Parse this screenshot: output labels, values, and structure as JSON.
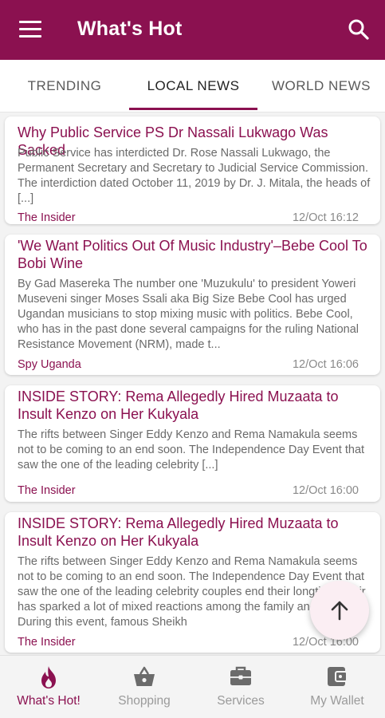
{
  "appbar": {
    "title": "What's Hot"
  },
  "tabs": [
    {
      "label": "TRENDING",
      "active": false
    },
    {
      "label": "LOCAL NEWS",
      "active": true
    },
    {
      "label": "WORLD NEWS",
      "active": false
    }
  ],
  "articles": [
    {
      "title": "Why Public Service PS Dr Nassali Lukwago Was Sacked",
      "summary": "Public Service has interdicted Dr. Rose Nassali Lukwago, the Permanent Secretary and Secretary to Judicial Service Commission. The interdiction dated October 11, 2019 by Dr. J. Mitala, the heads of [...]",
      "source": "The Insider",
      "time": "12/Oct 16:12"
    },
    {
      "title": "'We Want Politics Out Of Music Industry'–Bebe Cool To Bobi Wine",
      "summary": "By Gad Masereka The number one 'Muzukulu' to president Yoweri Museveni singer Moses Ssali aka Big Size Bebe Cool has urged Ugandan musicians to stop mixing music with politics. Bebe Cool, who has in the past done several campaigns for the ruling National Resistance Movement (NRM), made t...",
      "source": "Spy Uganda",
      "time": "12/Oct 16:06"
    },
    {
      "title": "INSIDE STORY: Rema Allegedly Hired Muzaata to Insult Kenzo on Her Kukyala",
      "summary": "The rifts between Singer Eddy Kenzo and Rema Namakula seems not to be coming to an end soon. The Independence Day Event that saw the one of the leading celebrity [...]",
      "source": "The Insider",
      "time": "12/Oct 16:00"
    },
    {
      "title": "INSIDE STORY: Rema Allegedly Hired Muzaata to Insult Kenzo on Her Kukyala",
      "summary": "The rifts between Singer Eddy Kenzo and Rema Namakula seems not to be coming to an end soon. The Independence Day Event that saw the one of the leading celebrity couples end their longtime affair has sparked a lot of mixed reactions among the family and friends. During this event, famous Sheikh",
      "source": "The Insider",
      "time": "12/Oct 16:00"
    }
  ],
  "bottom_nav": [
    {
      "label": "What's Hot!",
      "icon": "flame-icon",
      "active": true
    },
    {
      "label": "Shopping",
      "icon": "shopping-basket-icon",
      "active": false
    },
    {
      "label": "Services",
      "icon": "briefcase-icon",
      "active": false
    },
    {
      "label": "My Wallet",
      "icon": "wallet-icon",
      "active": false
    }
  ],
  "colors": {
    "primary": "#8b1150",
    "fab_bg": "#fbeef3",
    "inactive": "#9a9a9a"
  }
}
